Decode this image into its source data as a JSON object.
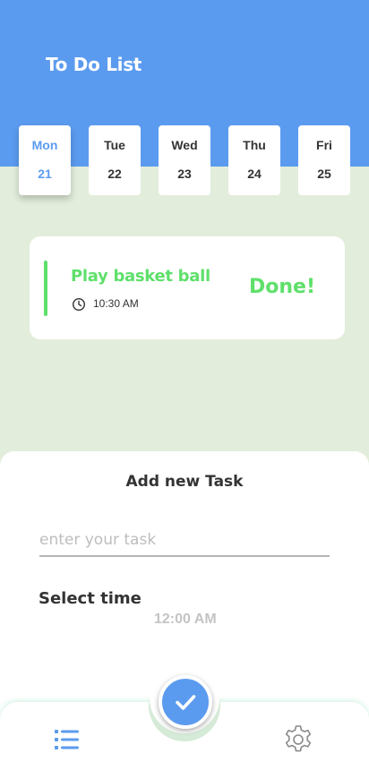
{
  "app": {
    "title": "To Do List"
  },
  "colors": {
    "primary": "#5b9bef",
    "success": "#5ee06b",
    "background": "#e2eddb"
  },
  "days": [
    {
      "name": "Mon",
      "num": "21",
      "active": true
    },
    {
      "name": "Tue",
      "num": "22",
      "active": false
    },
    {
      "name": "Wed",
      "num": "23",
      "active": false
    },
    {
      "name": "Thu",
      "num": "24",
      "active": false
    },
    {
      "name": "Fri",
      "num": "25",
      "active": false
    }
  ],
  "tasks": [
    {
      "title": "Play basket ball",
      "time": "10:30 AM",
      "status": "Done!",
      "icon": "clock-icon"
    }
  ],
  "add_task": {
    "title": "Add new Task",
    "input_value": "",
    "input_placeholder": "enter your task",
    "time_label": "Select time",
    "time_value": "12:00 AM"
  },
  "nav": {
    "left_icon": "list-icon",
    "center_icon": "check-icon",
    "right_icon": "gear-icon"
  }
}
